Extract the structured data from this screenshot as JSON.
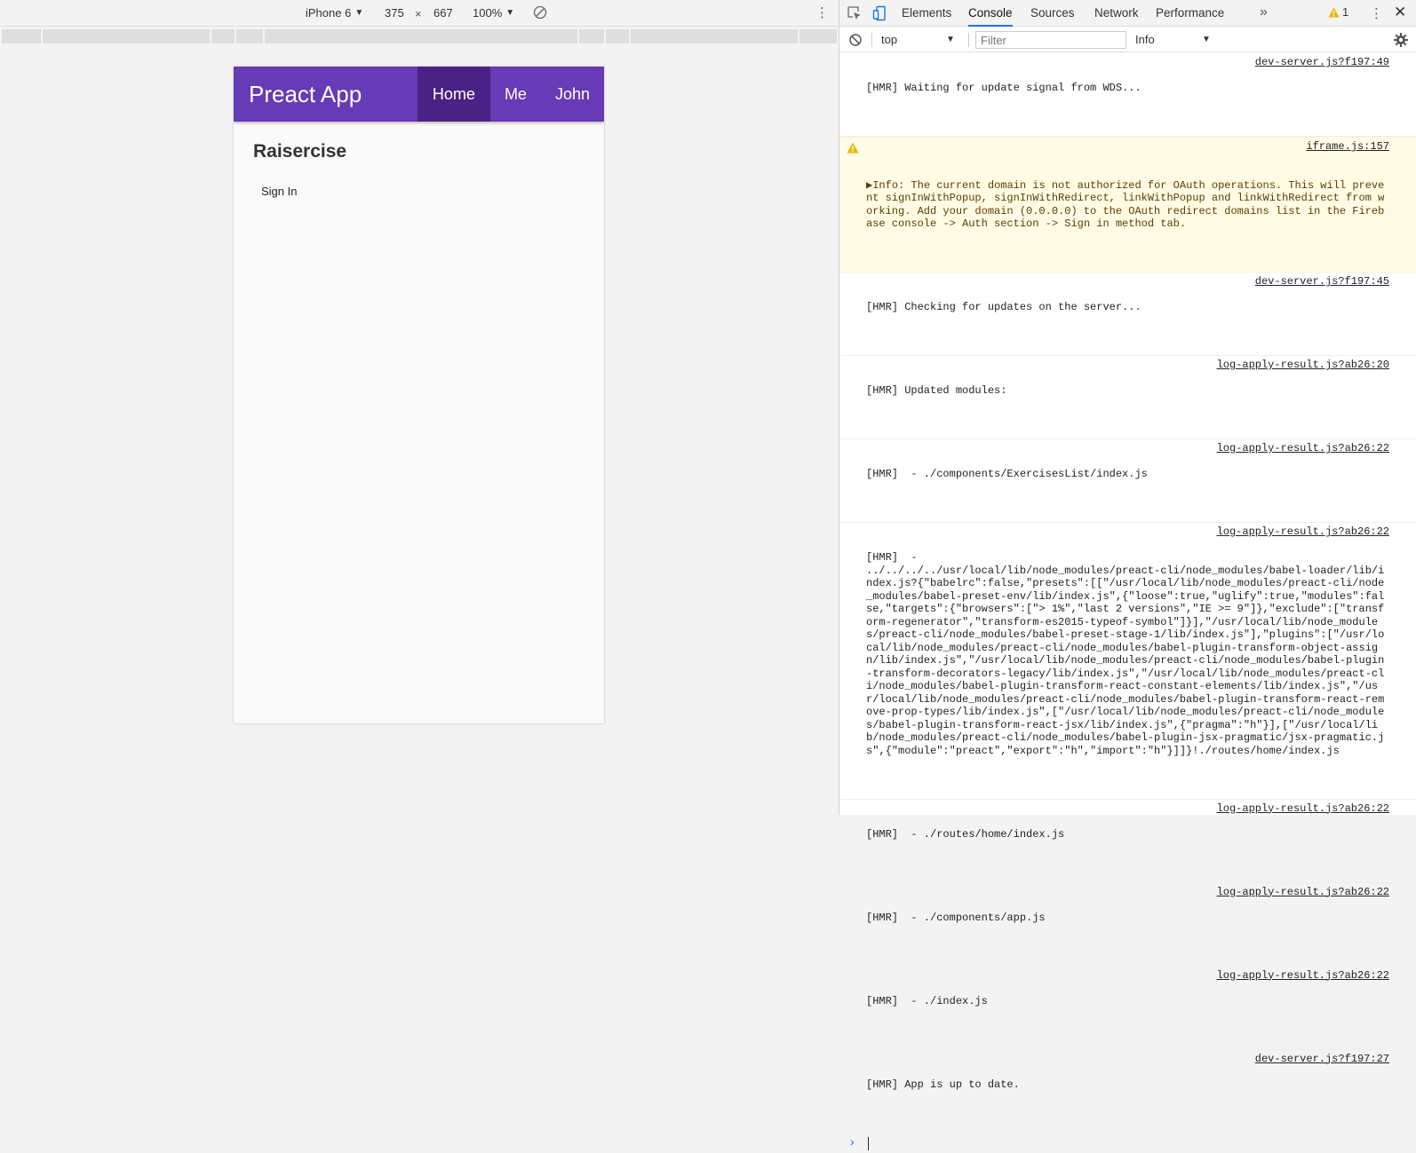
{
  "device_toolbar": {
    "device": "iPhone 6",
    "width": "375",
    "times": "×",
    "height": "667",
    "zoom": "100%"
  },
  "app": {
    "title": "Preact App",
    "nav": [
      {
        "label": "Home",
        "active": true
      },
      {
        "label": "Me",
        "active": false
      },
      {
        "label": "John",
        "active": false
      }
    ],
    "heading": "Raisercise",
    "sign_in": "Sign In",
    "header_color": "#673ab7",
    "active_nav_color": "#4a2185"
  },
  "devtools": {
    "tabs": [
      "Elements",
      "Console",
      "Sources",
      "Network",
      "Performance"
    ],
    "active_tab": "Console",
    "warning_count": "1",
    "console": {
      "context": "top",
      "filter_placeholder": "Filter",
      "level": "Info"
    },
    "messages": [
      {
        "text": "[HMR] Waiting for update signal from WDS...",
        "source": "dev-server.js?f197:49"
      },
      {
        "text": "▶Info: The current domain is not authorized for OAuth operations. This will prevent signInWithPopup, signInWithRedirect, linkWithPopup and linkWithRedirect from working. Add your domain (0.0.0.0) to the OAuth redirect domains list in the Firebase console -> Auth section -> Sign in method tab.",
        "source": "iframe.js:157",
        "level": "warning"
      },
      {
        "text": "[HMR] Checking for updates on the server...",
        "source": "dev-server.js?f197:45"
      },
      {
        "text": "[HMR] Updated modules:",
        "source": "log-apply-result.js?ab26:20"
      },
      {
        "text": "[HMR]  - ./components/ExercisesList/index.js",
        "source": "log-apply-result.js?ab26:22"
      },
      {
        "first": "[HMR]  -",
        "text": "../../../../usr/local/lib/node_modules/preact-cli/node_modules/babel-loader/lib/index.js?{\"babelrc\":false,\"presets\":[[\"/usr/local/lib/node_modules/preact-cli/node_modules/babel-preset-env/lib/index.js\",{\"loose\":true,\"uglify\":true,\"modules\":false,\"targets\":{\"browsers\":[\"> 1%\",\"last 2 versions\",\"IE >= 9\"]},\"exclude\":[\"transform-regenerator\",\"transform-es2015-typeof-symbol\"]}],\"/usr/local/lib/node_modules/preact-cli/node_modules/babel-preset-stage-1/lib/index.js\"],\"plugins\":[\"/usr/local/lib/node_modules/preact-cli/node_modules/babel-plugin-transform-object-assign/lib/index.js\",\"/usr/local/lib/node_modules/preact-cli/node_modules/babel-plugin-transform-decorators-legacy/lib/index.js\",\"/usr/local/lib/node_modules/preact-cli/node_modules/babel-plugin-transform-react-constant-elements/lib/index.js\",\"/usr/local/lib/node_modules/preact-cli/node_modules/babel-plugin-transform-react-remove-prop-types/lib/index.js\",[\"/usr/local/lib/node_modules/preact-cli/node_modules/babel-plugin-transform-react-jsx/lib/index.js\",{\"pragma\":\"h\"}],[\"/usr/local/lib/node_modules/preact-cli/node_modules/babel-plugin-jsx-pragmatic/jsx-pragmatic.js\",{\"module\":\"preact\",\"export\":\"h\",\"import\":\"h\"}]]}!./routes/home/index.js",
        "source": "log-apply-result.js?ab26:22"
      },
      {
        "text": "[HMR]  - ./routes/home/index.js",
        "source": "log-apply-result.js?ab26:22"
      },
      {
        "text": "[HMR]  - ./components/app.js",
        "source": "log-apply-result.js?ab26:22"
      },
      {
        "text": "[HMR]  - ./index.js",
        "source": "log-apply-result.js?ab26:22"
      },
      {
        "text": "[HMR] App is up to date.",
        "source": "dev-server.js?f197:27"
      }
    ]
  },
  "icons": {
    "inspect": "inspect-element-icon",
    "device": "device-toggle-icon",
    "rotate": "rotate-icon",
    "clear": "clear-console-icon",
    "gear": "settings-gear-icon",
    "warning": "warning-triangle-icon",
    "close": "close-icon",
    "more_tabs": "more-tabs-icon",
    "more": "kebab-menu-icon"
  }
}
